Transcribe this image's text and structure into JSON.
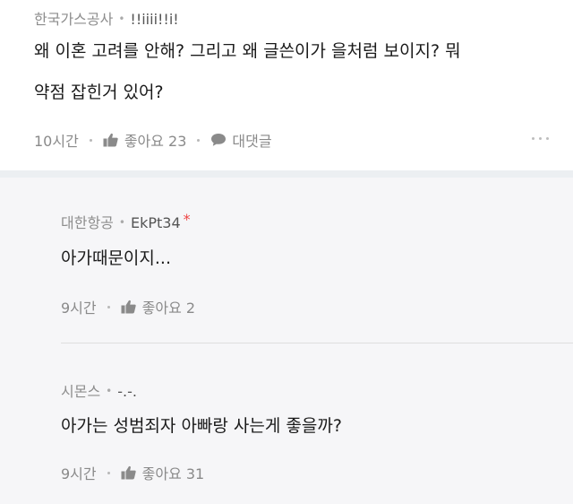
{
  "post": {
    "company": "한국가스공사",
    "nickname": "!!iiii!!i!",
    "line1": "왜 이혼 고려를 안해? 그리고 왜 글쓴이가 을처럼 보이지? 뭐",
    "line2": "약점 잡힌거 있어?",
    "time": "10시간",
    "like_label": "좋아요 23",
    "comment_label": "대댓글"
  },
  "replies": [
    {
      "company": "대한항공",
      "nickname": "EkPt34",
      "star": "*",
      "text": "아가때문이지...",
      "time": "9시간",
      "like_label": "좋아요 2"
    },
    {
      "company": "시몬스",
      "nickname": "-.-.",
      "text": "아가는 성범죄자 아빠랑 사는게 좋을까?",
      "time": "9시간",
      "like_label": "좋아요 31"
    }
  ],
  "colors": {
    "background": "#f6f6f8",
    "post_background": "#ffffff",
    "star": "#ee4444"
  },
  "icons": [
    "thumbs-up-icon",
    "speech-bubble-icon",
    "more-dots-icon"
  ]
}
